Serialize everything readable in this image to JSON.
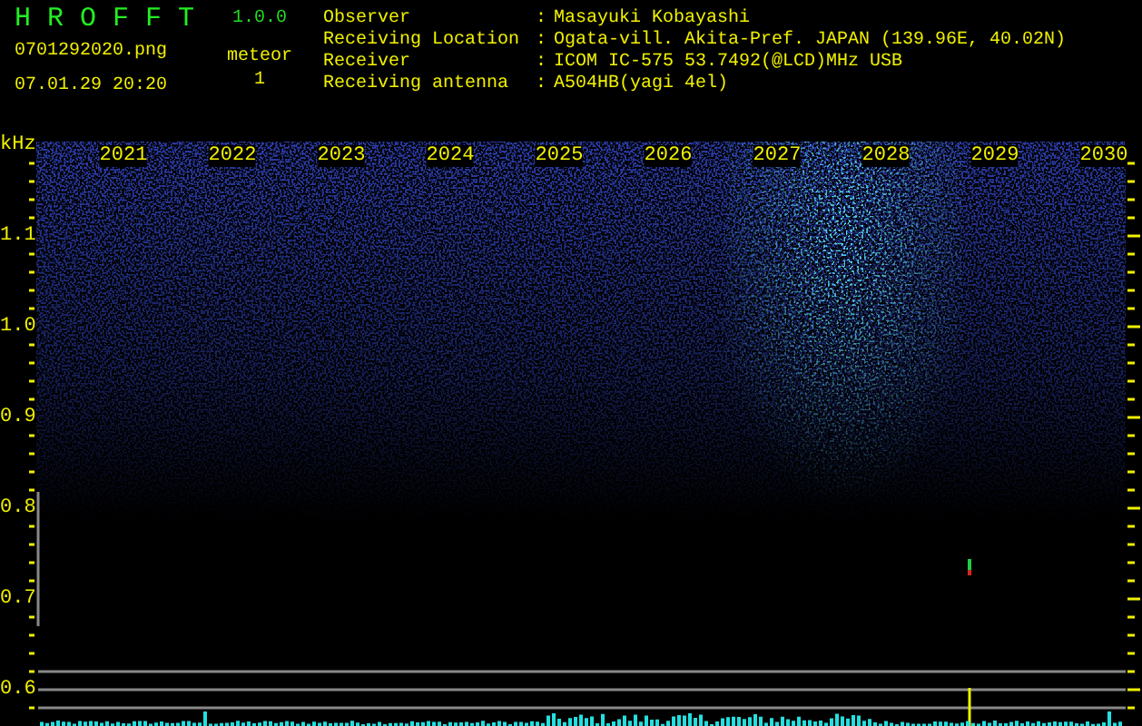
{
  "app": {
    "title": "H R O F F T",
    "version": "1.0.0",
    "file_name": "0701292020.png",
    "date_time": "07.01.29 20:20",
    "meteor_label": "meteor",
    "meteor_count": "1"
  },
  "info": [
    {
      "label": "Observer",
      "separator": ":",
      "value": "Masayuki Kobayashi"
    },
    {
      "label": "Receiving Location",
      "separator": ":",
      "value": "Ogata-vill. Akita-Pref. JAPAN (139.96E, 40.02N)"
    },
    {
      "label": "Receiver",
      "separator": ":",
      "value": "ICOM IC-575 53.7492(@LCD)MHz USB"
    },
    {
      "label": "Receiving antenna",
      "separator": ":",
      "value": "A504HB(yagi 4el)"
    }
  ],
  "plot": {
    "unit": "kHz",
    "time_labels": [
      "2021",
      "2022",
      "2023",
      "2024",
      "2025",
      "2026",
      "2027",
      "2028",
      "2029",
      "2030"
    ],
    "freq_labels": [
      "1.1",
      "1.0",
      "0.9",
      "0.8",
      "0.7",
      "0.6"
    ]
  }
}
